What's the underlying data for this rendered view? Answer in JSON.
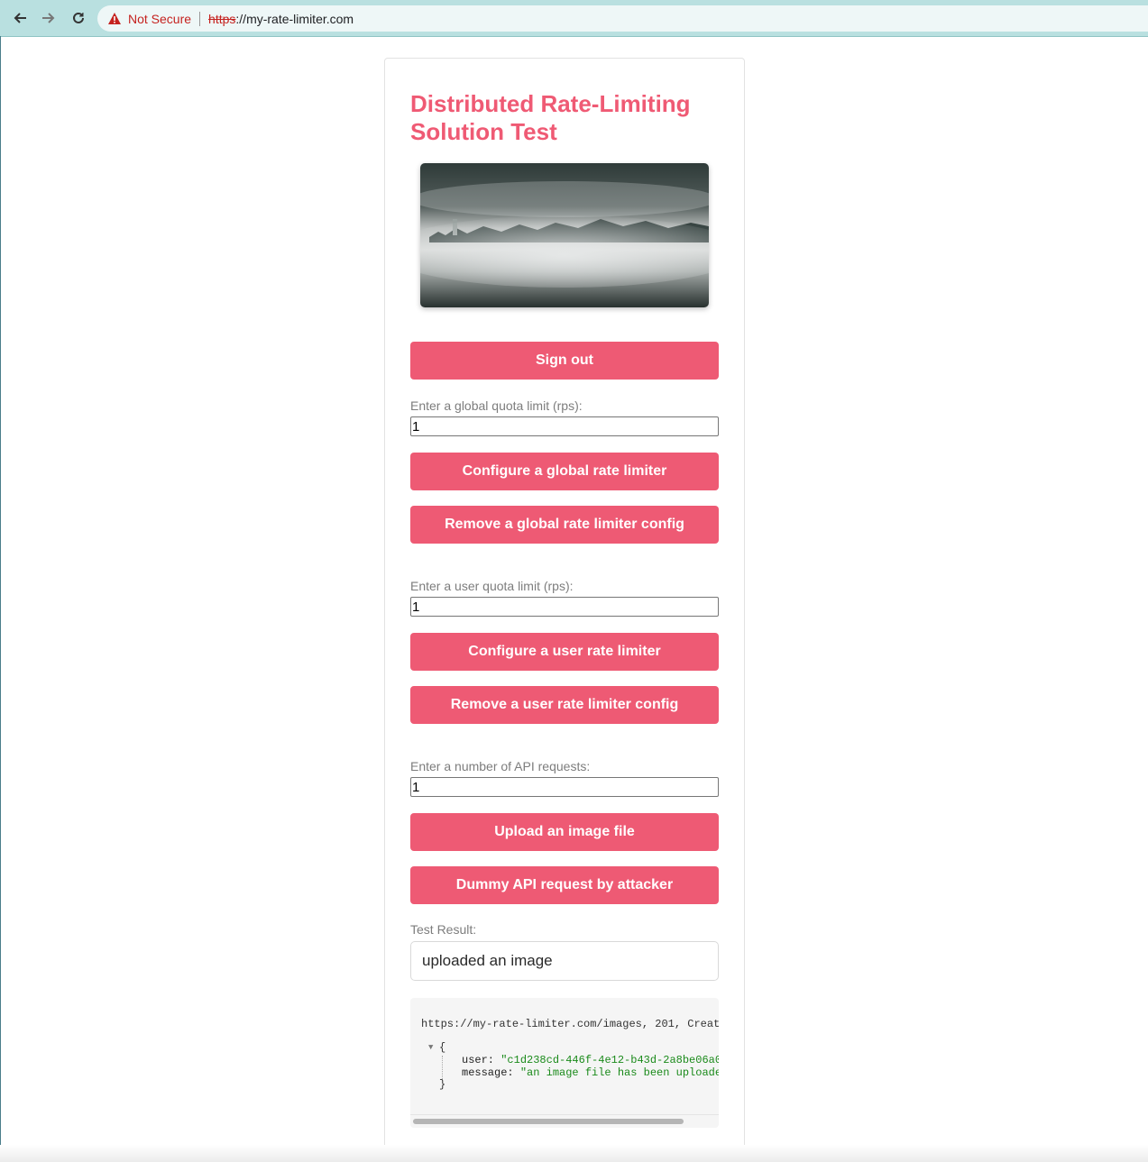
{
  "browser": {
    "security_label": "Not Secure",
    "url_scheme": "https",
    "url_rest": "://my-rate-limiter.com"
  },
  "page": {
    "title": "Distributed Rate-Limiting Solution Test",
    "hero_image_alt": "foggy forest landscape"
  },
  "buttons": {
    "sign_out": "Sign out",
    "configure_global": "Configure a global rate limiter",
    "remove_global": "Remove a global rate limiter config",
    "configure_user": "Configure a user rate limiter",
    "remove_user": "Remove a user rate limiter config",
    "upload_image": "Upload an image file",
    "dummy_request": "Dummy API request by attacker"
  },
  "inputs": {
    "global_quota_label": "Enter a global quota limit (rps):",
    "global_quota_value": "1",
    "user_quota_label": "Enter a user quota limit (rps):",
    "user_quota_value": "1",
    "api_requests_label": "Enter a number of API requests:",
    "api_requests_value": "1"
  },
  "result": {
    "label": "Test Result:",
    "value": "uploaded an image"
  },
  "log": {
    "header": "https://my-rate-limiter.com/images, 201, Creat",
    "open_brace": "{",
    "user_key": "user:",
    "user_value": "\"c1d238cd-446f-4e12-b43d-2a8be06a0",
    "message_key": "message:",
    "message_value": "\"an image file has been uploade",
    "close_brace": "}"
  },
  "colors": {
    "accent": "#ee5a74",
    "title": "#ef5a74",
    "warning": "#c5221f"
  }
}
